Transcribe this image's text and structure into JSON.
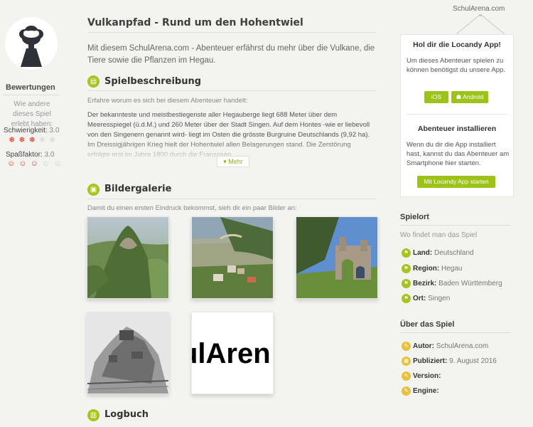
{
  "brand": "SchulArena.com",
  "left": {
    "ratings_title": "Bewertungen",
    "ratings_sub": "Wie andere dieses Spiel erlebt haben:",
    "difficulty_label": "Schwierigkeit:",
    "difficulty_value": "3.0",
    "difficulty_rating": 3,
    "fun_label": "Spaßfaktor:",
    "fun_value": "3.0",
    "fun_rating": 3,
    "rating_max": 5
  },
  "main": {
    "title": "Vulkanpfad - Rund um den Hohentwiel",
    "intro": "Mit diesem SchulArena.com - Abenteuer erfährst du mehr über die Vulkane, die Tiere sowie die Pflanzen im Hegau.",
    "section_description": {
      "heading": "Spielbeschreibung",
      "sub": "Erfahre worum es sich bei diesem Abenteuer handelt:",
      "text": "Der bekannteste und meistbestiegenste aller Hegauberge liegt 688 Meter über dem Meeresspiegel (ü.d.M.) und 260 Meter über der Stadt Singen. Auf dem Hontes -wie er liebevoll von den Singenern genannt wird- liegt im Osten die grösste Burgruine Deutschlands (9,92 ha). Im Dreissigjährigen Krieg hielt der Hohentwiel allen Belagerungen stand. Die Zerstörung erfolgte erst im Jahre 1800 durch die Franzosen.",
      "more_label": "▾ Mehr"
    },
    "section_gallery": {
      "heading": "Bildergalerie",
      "sub": "Damit du einen ersten Eindruck bekommst, sieh dir ein paar Bilder an:",
      "logo_text": "ulAren"
    },
    "section_log": {
      "heading": "Logbuch"
    }
  },
  "app_card": {
    "title": "Hol dir die Locandy App!",
    "text": "Um dieses Abenteuer spielen zu können benötigst du unsere App.",
    "ios_label": "iOS",
    "android_label": "Android",
    "install_title": "Abenteuer installieren",
    "install_text": "Wenn du dir die App installiert hast, kannst du das Abenteuer am Smartphone hier starten.",
    "start_label": "Mit Locandy App starten"
  },
  "location": {
    "heading": "Spielort",
    "sub": "Wo findet man das Spiel",
    "items": [
      {
        "key": "Land:",
        "value": "Deutschland"
      },
      {
        "key": "Region:",
        "value": "Hegau"
      },
      {
        "key": "Bezirk:",
        "value": "Baden Württemberg"
      },
      {
        "key": "Ort:",
        "value": "Singen"
      }
    ]
  },
  "about": {
    "heading": "Über das Spiel",
    "items": [
      {
        "key": "Autor:",
        "value": "SchulArena.com"
      },
      {
        "key": "Publiziert:",
        "value": "9. August 2016"
      },
      {
        "key": "Version:",
        "value": ""
      },
      {
        "key": "Engine:",
        "value": ""
      }
    ]
  },
  "colors": {
    "accent": "#a8c41c",
    "button": "#9dc218",
    "rating_active": "#e3402f",
    "about_icon": "#e7c23a"
  }
}
